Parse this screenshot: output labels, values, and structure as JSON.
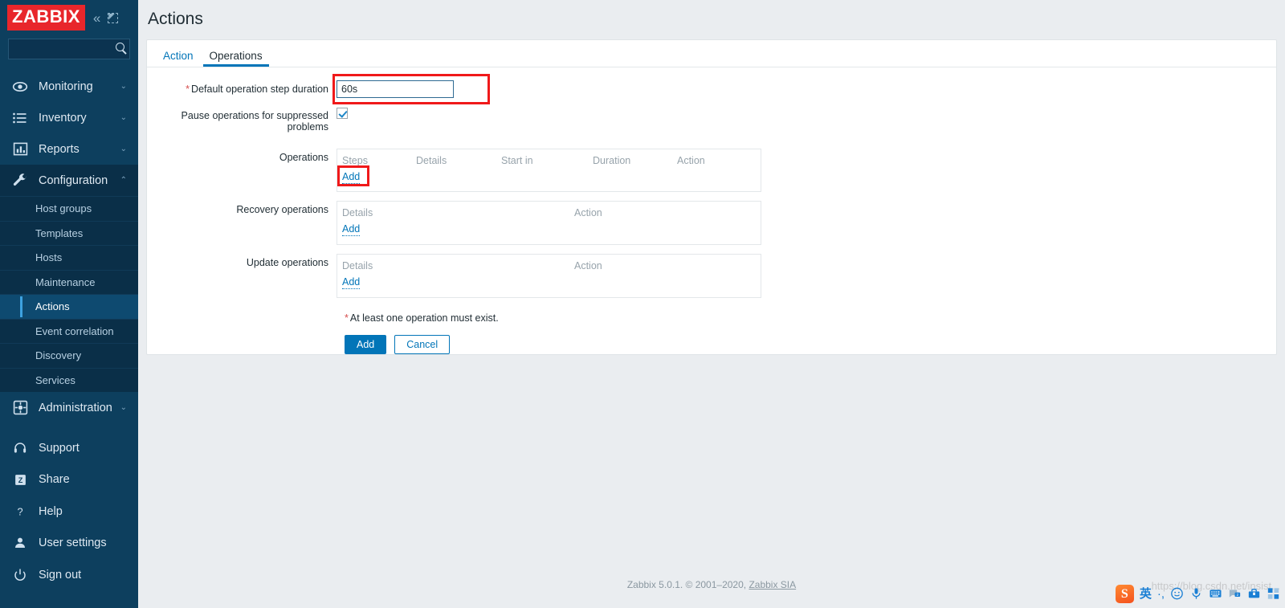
{
  "sidebar": {
    "logo": "ZABBIX",
    "collapse_icon": "chevrons-left-icon",
    "expand_icon": "dashed-expand-icon",
    "search_placeholder": "",
    "search_value": "",
    "nav": [
      {
        "label": "Monitoring",
        "icon": "eye-icon",
        "chevron": "⌄"
      },
      {
        "label": "Inventory",
        "icon": "list-icon",
        "chevron": "⌄"
      },
      {
        "label": "Reports",
        "icon": "bar-chart-icon",
        "chevron": "⌄"
      },
      {
        "label": "Configuration",
        "icon": "wrench-icon",
        "chevron": "⌃"
      }
    ],
    "submenu": [
      "Host groups",
      "Templates",
      "Hosts",
      "Maintenance",
      "Actions",
      "Event correlation",
      "Discovery",
      "Services"
    ],
    "selected_submenu": "Actions",
    "administration": {
      "label": "Administration",
      "icon": "gear-icon",
      "chevron": "⌄"
    },
    "bottom": [
      {
        "label": "Support",
        "icon": "headset-icon"
      },
      {
        "label": "Share",
        "icon": "zabbix-z-icon"
      },
      {
        "label": "Help",
        "icon": "question-icon"
      },
      {
        "label": "User settings",
        "icon": "person-icon"
      },
      {
        "label": "Sign out",
        "icon": "power-icon"
      }
    ]
  },
  "page": {
    "title": "Actions"
  },
  "tabs": [
    {
      "label": "Action",
      "active": false
    },
    {
      "label": "Operations",
      "active": true
    }
  ],
  "form": {
    "default_step_duration": {
      "label": "Default operation step duration",
      "required_marker": "*",
      "value": "60s",
      "highlighted": true
    },
    "pause_suppressed": {
      "label": "Pause operations for suppressed problems",
      "checked": true
    },
    "operations": {
      "label": "Operations",
      "columns": [
        "Steps",
        "Details",
        "Start in",
        "Duration",
        "Action"
      ],
      "rows": [],
      "add_label": "Add",
      "add_highlighted": true
    },
    "recovery_operations": {
      "label": "Recovery operations",
      "columns": [
        "Details",
        "Action"
      ],
      "rows": [],
      "add_label": "Add"
    },
    "update_operations": {
      "label": "Update operations",
      "columns": [
        "Details",
        "Action"
      ],
      "rows": [],
      "add_label": "Add"
    },
    "error_note": {
      "marker": "*",
      "text": "At least one operation must exist."
    },
    "buttons": {
      "submit": "Add",
      "cancel": "Cancel"
    }
  },
  "footer": {
    "text": "Zabbix 5.0.1. © 2001–2020, ",
    "link": "Zabbix SIA"
  },
  "ime": {
    "logo": "sogou-logo-icon",
    "items": [
      {
        "name": "language-mode-cn",
        "glyph": "英"
      },
      {
        "name": "punctuation-toggle-icon",
        "glyph": "·,"
      },
      {
        "name": "emoji-icon",
        "glyph": "☺"
      },
      {
        "name": "microphone-icon",
        "glyph": ""
      },
      {
        "name": "keyboard-icon",
        "glyph": ""
      },
      {
        "name": "speech-bubble-icon",
        "glyph": ""
      },
      {
        "name": "toolbox-icon",
        "glyph": ""
      },
      {
        "name": "app-grid-icon",
        "glyph": ""
      }
    ]
  },
  "watermark": "https://blog.csdn.net/insist..."
}
